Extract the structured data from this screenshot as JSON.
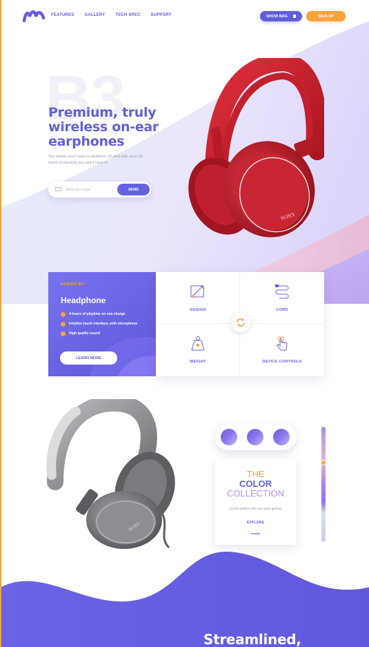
{
  "nav": {
    "items": [
      "FEATURES",
      "GALLERY",
      "TECH SPEC",
      "SUPPORT"
    ],
    "show_bag": "SHOW BAG",
    "sign_up": "SIGN UP"
  },
  "hero": {
    "watermark": "B3",
    "title": "Premium, truly wireless on-ear earphones",
    "subtitle": "You simply won't want to takethom off. And with up to 30 hours of playtime you won't have to.",
    "email_placeholder": "Write your email",
    "send_label": "SEND"
  },
  "feature_card": {
    "kicker": "DESIGN BY:",
    "title": "Headphone",
    "features": [
      "4 hours of playtime on one charge",
      "Intuitive touch interface, with microphone",
      "High quality sound"
    ],
    "cta": "LEARN MORE",
    "cells": [
      "DESIGN",
      "CORD",
      "WEIGHT",
      "DEVICE CONTROLS"
    ]
  },
  "color_collection": {
    "line1": "THE",
    "line2": "COLOR",
    "line3": "COLLECTION",
    "description": "Let the world in with one quick gesture",
    "explore": "EXPLORE"
  },
  "bottom": {
    "title": "Streamlined,"
  },
  "colors": {
    "primary": "#5e5fd8",
    "accent": "#f7a33d",
    "headphone_red": "#c8202c",
    "headphone_grey": "#8a8a8f"
  },
  "icons": [
    "logo-icon",
    "bag-icon",
    "mail-icon",
    "check-icon",
    "design-icon",
    "cord-icon",
    "weight-icon",
    "touch-icon",
    "swap-icon"
  ]
}
